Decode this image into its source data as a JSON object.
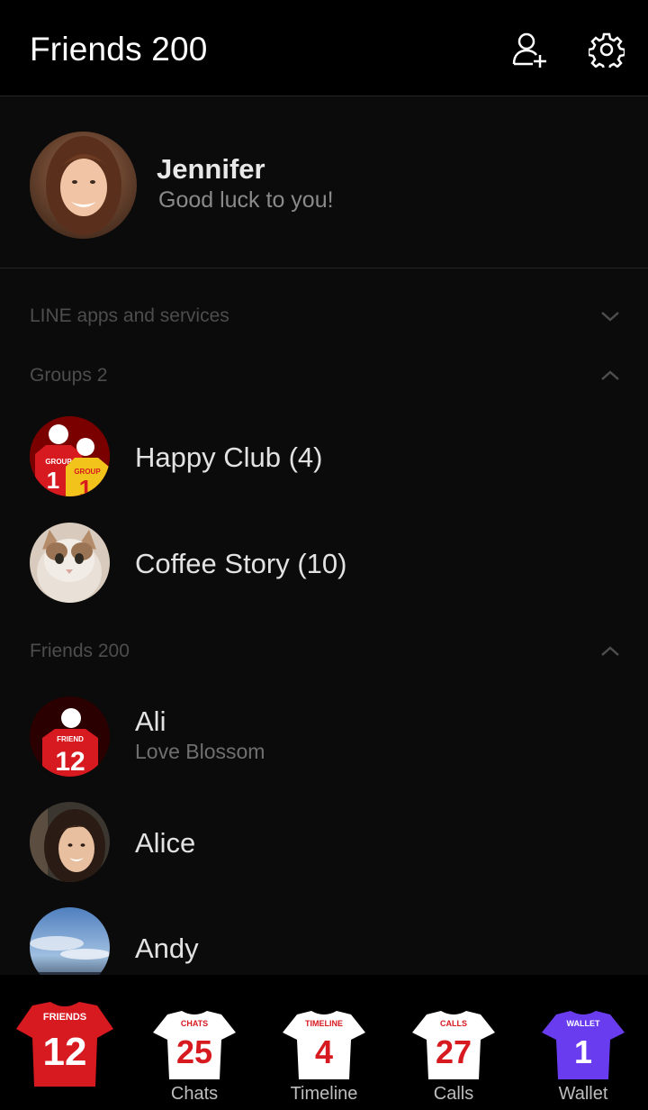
{
  "header": {
    "title": "Friends 200"
  },
  "profile": {
    "name": "Jennifer",
    "status": "Good luck to you!"
  },
  "sections": {
    "services": "LINE apps and services",
    "groups": "Groups 2",
    "friends": "Friends 200"
  },
  "groups": [
    {
      "name": "Happy Club (4)",
      "jersey_text": "GROUP",
      "jersey_number": "1"
    },
    {
      "name": "Coffee Story (10)"
    }
  ],
  "friends": [
    {
      "name": "Ali",
      "status": "Love Blossom",
      "jersey_text": "FRIEND",
      "jersey_number": "12"
    },
    {
      "name": "Alice"
    },
    {
      "name": "Andy"
    }
  ],
  "tabs": [
    {
      "label": "",
      "jersey_text": "FRIENDS",
      "number": "12",
      "color": "#d71920",
      "text_color": "#ffffff"
    },
    {
      "label": "Chats",
      "jersey_text": "CHATS",
      "number": "25",
      "color": "#ffffff",
      "text_color": "#d71920"
    },
    {
      "label": "Timeline",
      "jersey_text": "TIMELINE",
      "number": "4",
      "color": "#ffffff",
      "text_color": "#d71920"
    },
    {
      "label": "Calls",
      "jersey_text": "CALLS",
      "number": "27",
      "color": "#ffffff",
      "text_color": "#d71920"
    },
    {
      "label": "Wallet",
      "jersey_text": "WALLET",
      "number": "1",
      "color": "#6a3cf0",
      "text_color": "#ffffff"
    }
  ],
  "icons": {
    "add_friend": "add-friend-icon",
    "settings": "gear-icon"
  }
}
